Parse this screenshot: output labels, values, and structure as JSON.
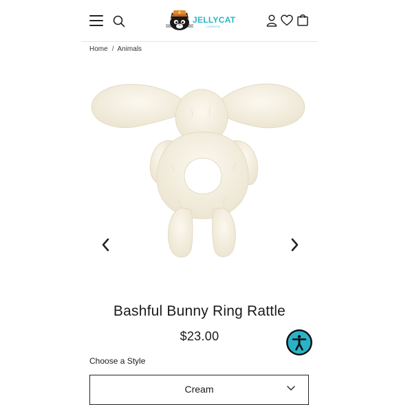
{
  "header": {
    "brand": "JELLYCAT",
    "brand_sub": "LONDON",
    "icons": [
      "hamburger-menu-icon",
      "search-icon",
      "account-icon",
      "heart-icon",
      "shopping-bag-icon"
    ]
  },
  "breadcrumb": {
    "items": [
      "Home",
      "Animals"
    ],
    "separator": "/"
  },
  "product": {
    "title": "Bashful Bunny Ring Rattle",
    "price": "$23.00",
    "style_label": "Choose a Style",
    "style_selected": "Cream"
  },
  "colors": {
    "logo": "#2ab3c8",
    "toy_cream": "#f4efe2",
    "accessibility_button": "#2ab3c8"
  }
}
